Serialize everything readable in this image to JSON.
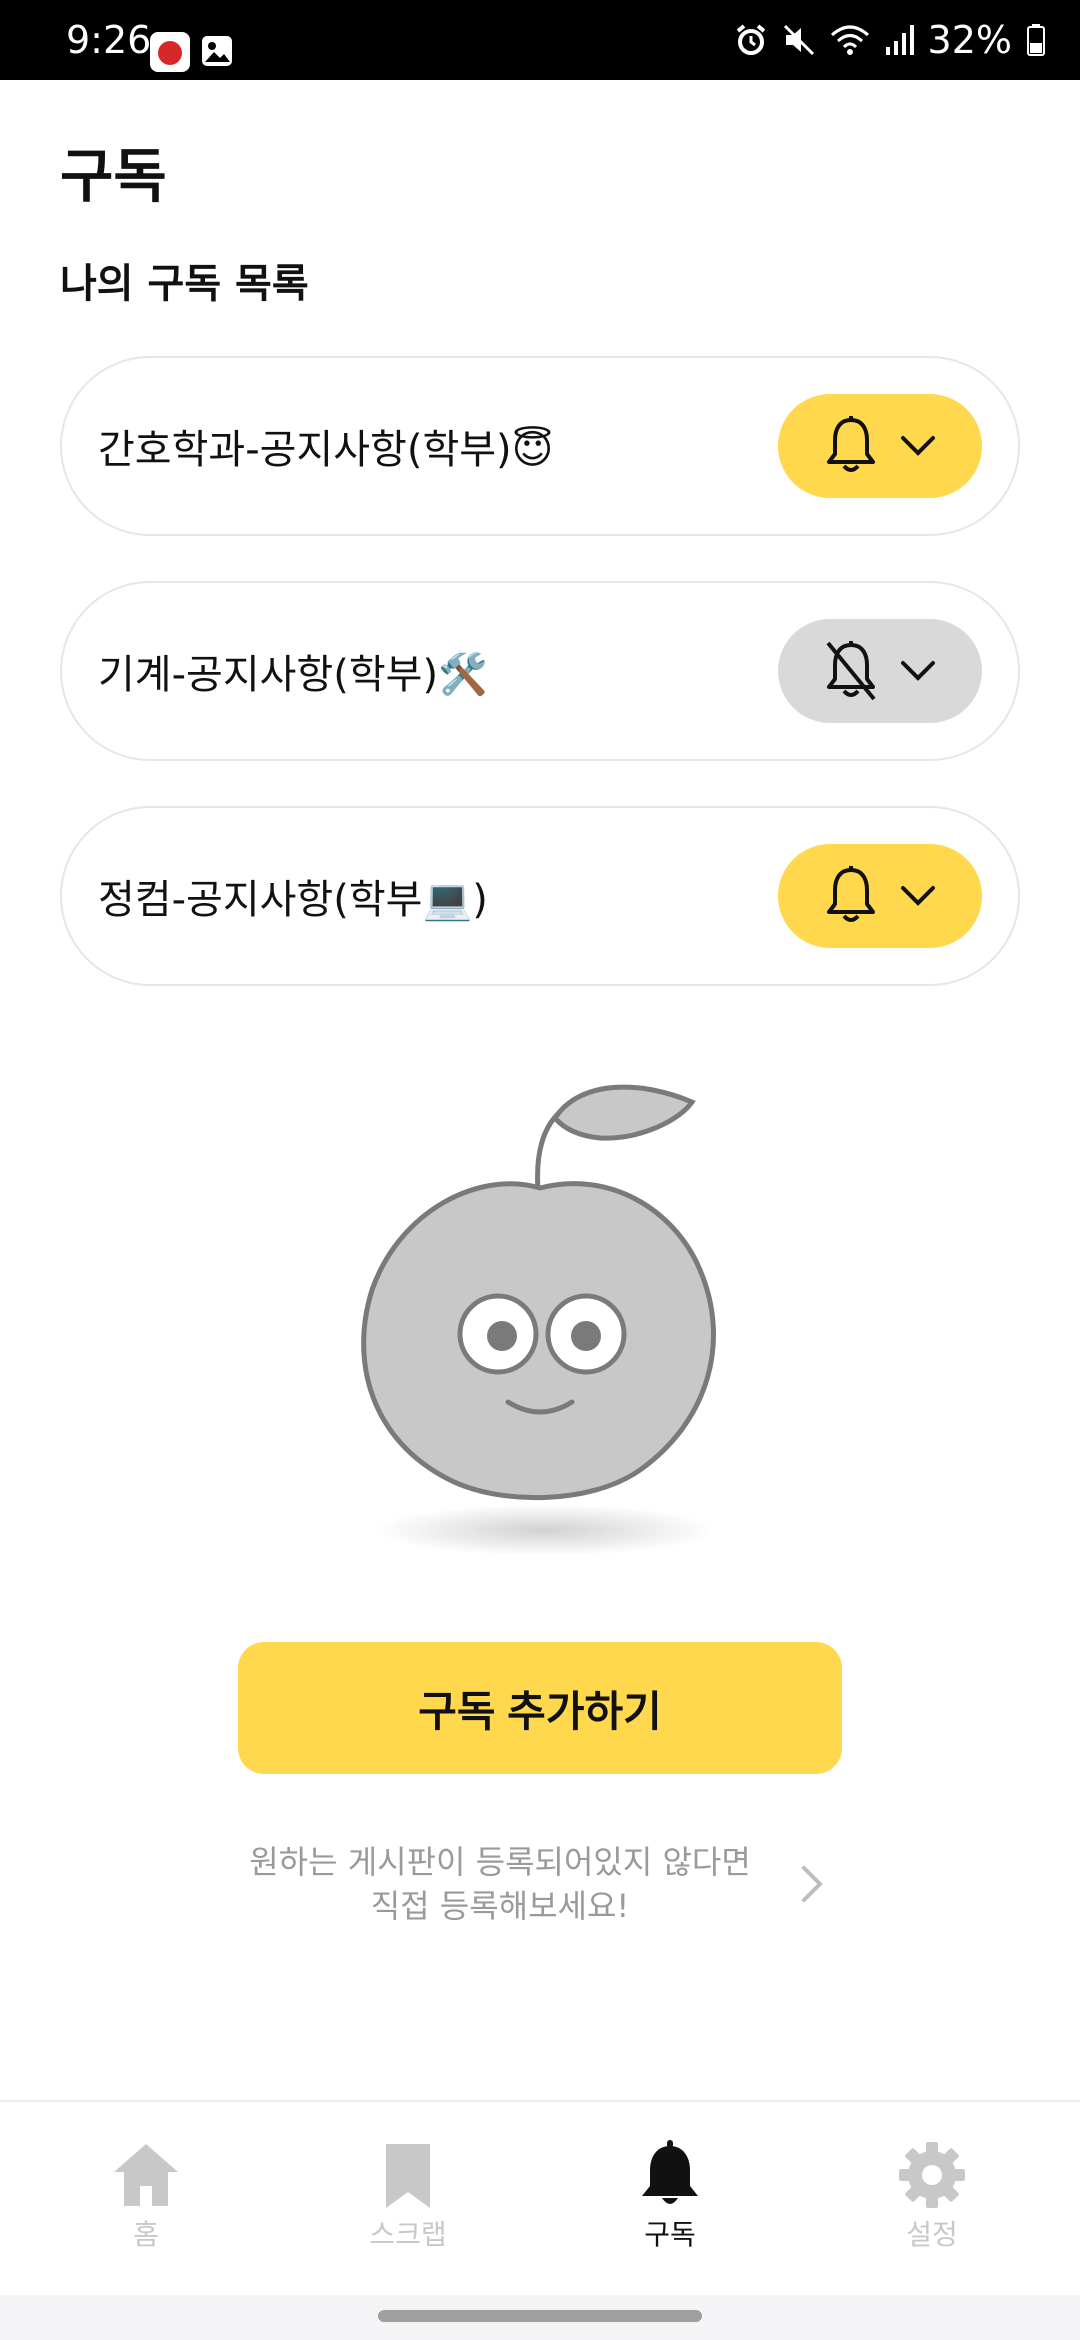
{
  "status_bar": {
    "time": "9:26",
    "battery": "32%",
    "icons": [
      "app-cherry-icon",
      "gallery-icon",
      "alarm-icon",
      "mute-icon",
      "wifi-icon",
      "signal-icon",
      "battery-icon"
    ]
  },
  "page": {
    "title": "구독",
    "section_title": "나의 구독 목록"
  },
  "subscriptions": [
    {
      "label": "간호학과-공지사항(학부)😇",
      "notifications_on": true,
      "toggle_icons": [
        "bell-icon",
        "chevron-down-icon"
      ]
    },
    {
      "label": "기계-공지사항(학부)🛠️",
      "notifications_on": false,
      "toggle_icons": [
        "bell-off-icon",
        "chevron-down-icon"
      ]
    },
    {
      "label": "정컴-공지사항(학부💻)",
      "notifications_on": true,
      "toggle_icons": [
        "bell-icon",
        "chevron-down-icon"
      ]
    }
  ],
  "add_button_label": "구독 추가하기",
  "register_hint": {
    "line1": "원하는 게시판이 등록되어있지 않다면",
    "line2": "직접 등록해보세요!"
  },
  "bottom_nav": [
    {
      "label": "홈",
      "icon": "home-icon",
      "active": false
    },
    {
      "label": "스크랩",
      "icon": "bookmark-icon",
      "active": false
    },
    {
      "label": "구독",
      "icon": "bell-icon",
      "active": true
    },
    {
      "label": "설정",
      "icon": "gear-icon",
      "active": false
    }
  ],
  "colors": {
    "accent": "#ffd84d",
    "toggle_off": "#d9d9d9",
    "muted_text": "#9a9a9a",
    "nav_inactive": "#c8c8c8",
    "mascot_fill": "#c8c8c8",
    "mascot_stroke": "#7a7a7a"
  }
}
